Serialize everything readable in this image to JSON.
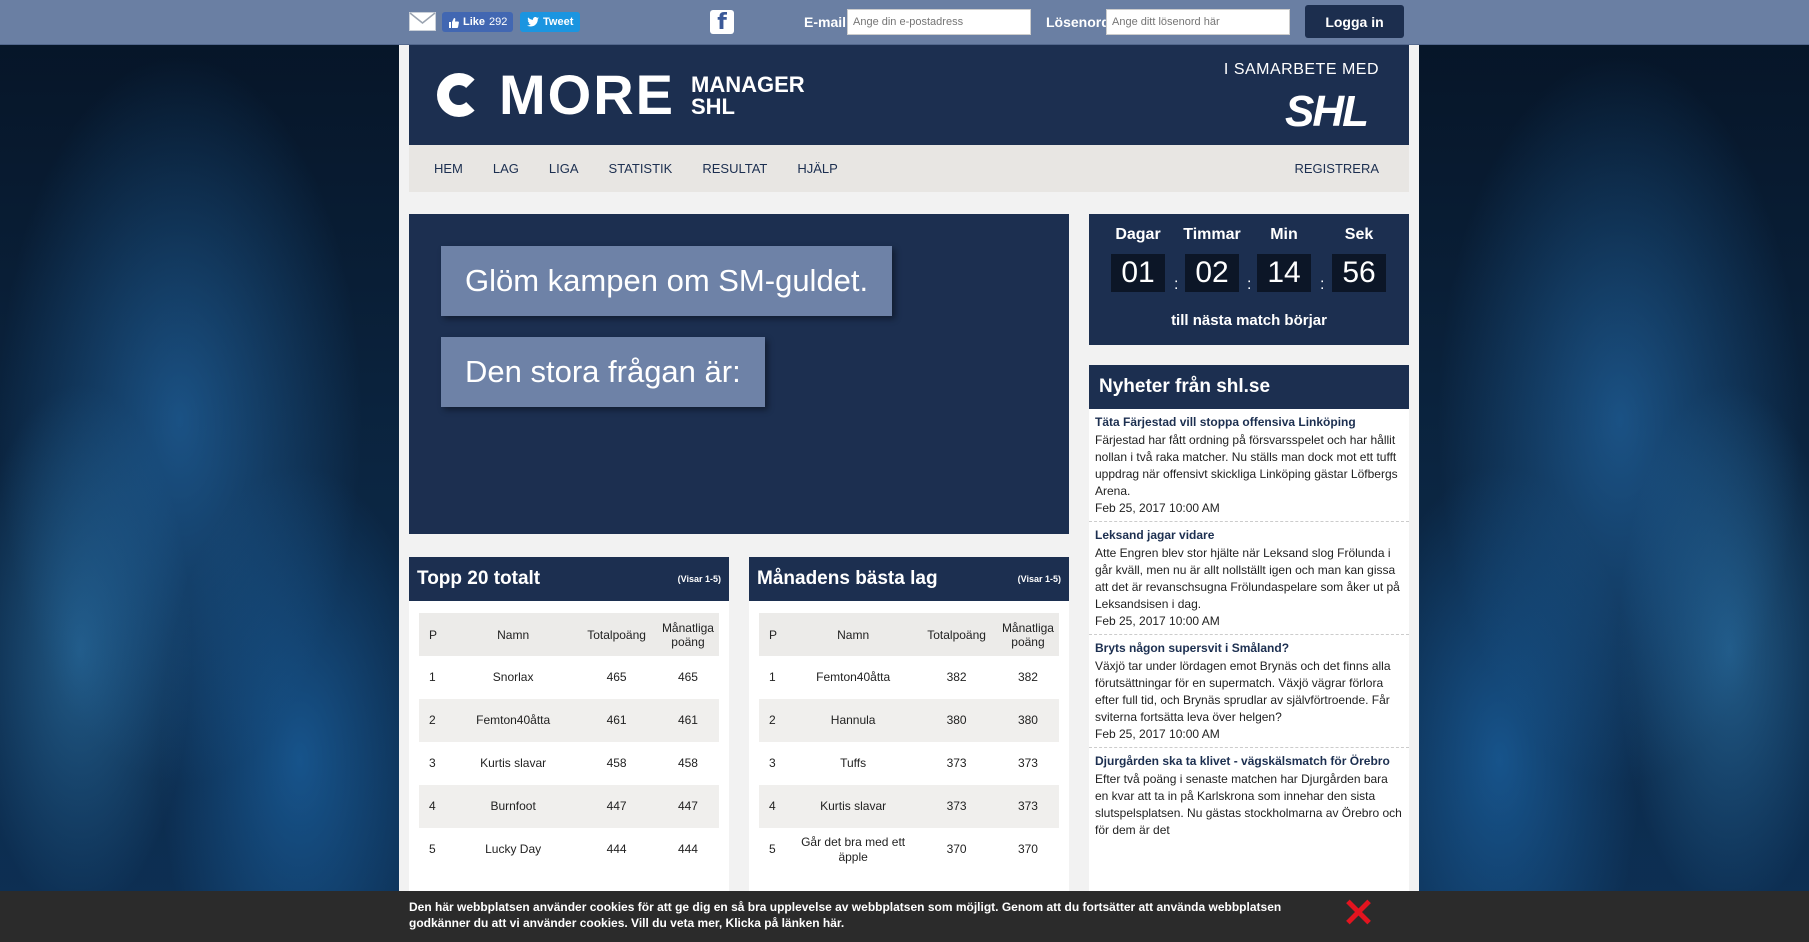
{
  "topbar": {
    "like_label": "Like",
    "like_count": "292",
    "tweet_label": "Tweet",
    "email_label": "E-mail",
    "email_placeholder": "Ange din e-postadress",
    "password_label": "Lösenord",
    "password_placeholder": "Ange ditt lösenord här",
    "login_label": "Logga in"
  },
  "header": {
    "logo_main": "MORE",
    "logo_line1": "MANAGER",
    "logo_line2": "SHL",
    "partner_text": "I SAMARBETE MED",
    "partner_logo": "SHL"
  },
  "nav": {
    "items": [
      "HEM",
      "LAG",
      "LIGA",
      "STATISTIK",
      "RESULTAT",
      "HJÄLP"
    ],
    "register": "REGISTRERA"
  },
  "hero": {
    "line1": "Glöm kampen om SM-guldet.",
    "line2": "Den stora frågan är:"
  },
  "countdown": {
    "labels": [
      "Dagar",
      "Timmar",
      "Min",
      "Sek"
    ],
    "values": [
      "01",
      "02",
      "14",
      "56"
    ],
    "footer": "till nästa match börjar"
  },
  "news": {
    "title": "Nyheter från shl.se",
    "items": [
      {
        "title": "Täta Färjestad vill stoppa offensiva Linköping",
        "body": "Färjestad har fått ordning på försvarsspelet och har hållit nollan i två raka matcher. Nu ställs man dock mot ett tufft uppdrag när offensivt skickliga Linköping gästar Löfbergs Arena.",
        "date": "Feb 25, 2017 10:00 AM"
      },
      {
        "title": "Leksand jagar vidare",
        "body": "Atte Engren blev stor hjälte när Leksand slog Frölunda i går kväll, men nu är allt nollställt igen och man kan gissa att det är revanschsugna Frölundaspelare som åker ut på Leksandsisen i dag.",
        "date": "Feb 25, 2017 10:00 AM"
      },
      {
        "title": "Bryts någon supersvit i Småland?",
        "body": "Växjö tar under lördagen emot Brynäs och det finns alla förutsättningar för en supermatch. Växjö vägrar förlora efter full tid, och Brynäs sprudlar av självförtroende. Får sviterna fortsätta leva över helgen?",
        "date": "Feb 25, 2017 10:00 AM"
      },
      {
        "title": "Djurgården ska ta klivet - vägskälsmatch för Örebro",
        "body": "Efter två poäng i senaste matchen har Djurgården bara en kvar att ta in på Karlskrona som innehar den sista slutspelsplatsen. Nu gästas stockholmarna av Örebro och för dem är det",
        "date": ""
      }
    ]
  },
  "top20": {
    "title": "Topp 20 totalt",
    "tag": "(Visar 1-5)",
    "headers": [
      "P",
      "Namn",
      "Totalpoäng",
      "Månatliga poäng"
    ],
    "rows": [
      [
        "1",
        "Snorlax",
        "465",
        "465"
      ],
      [
        "2",
        "Femton40åtta",
        "461",
        "461"
      ],
      [
        "3",
        "Kurtis slavar",
        "458",
        "458"
      ],
      [
        "4",
        "Burnfoot",
        "447",
        "447"
      ],
      [
        "5",
        "Lucky Day",
        "444",
        "444"
      ]
    ]
  },
  "monthly": {
    "title": "Månadens bästa lag",
    "tag": "(Visar 1-5)",
    "headers": [
      "P",
      "Namn",
      "Totalpoäng",
      "Månatliga poäng"
    ],
    "rows": [
      [
        "1",
        "Femton40åtta",
        "382",
        "382"
      ],
      [
        "2",
        "Hannula",
        "380",
        "380"
      ],
      [
        "3",
        "Tuffs",
        "373",
        "373"
      ],
      [
        "4",
        "Kurtis slavar",
        "373",
        "373"
      ],
      [
        "5",
        "Går det bra med ett äpple",
        "370",
        "370"
      ]
    ]
  },
  "cookie": {
    "text": "Den här webbplatsen använder cookies för att ge dig en så bra upplevelse av webbplatsen som möjligt. Genom att du fortsätter att använda webbplatsen godkänner du att vi använder cookies. Vill du veta mer, Klicka på länken här."
  }
}
